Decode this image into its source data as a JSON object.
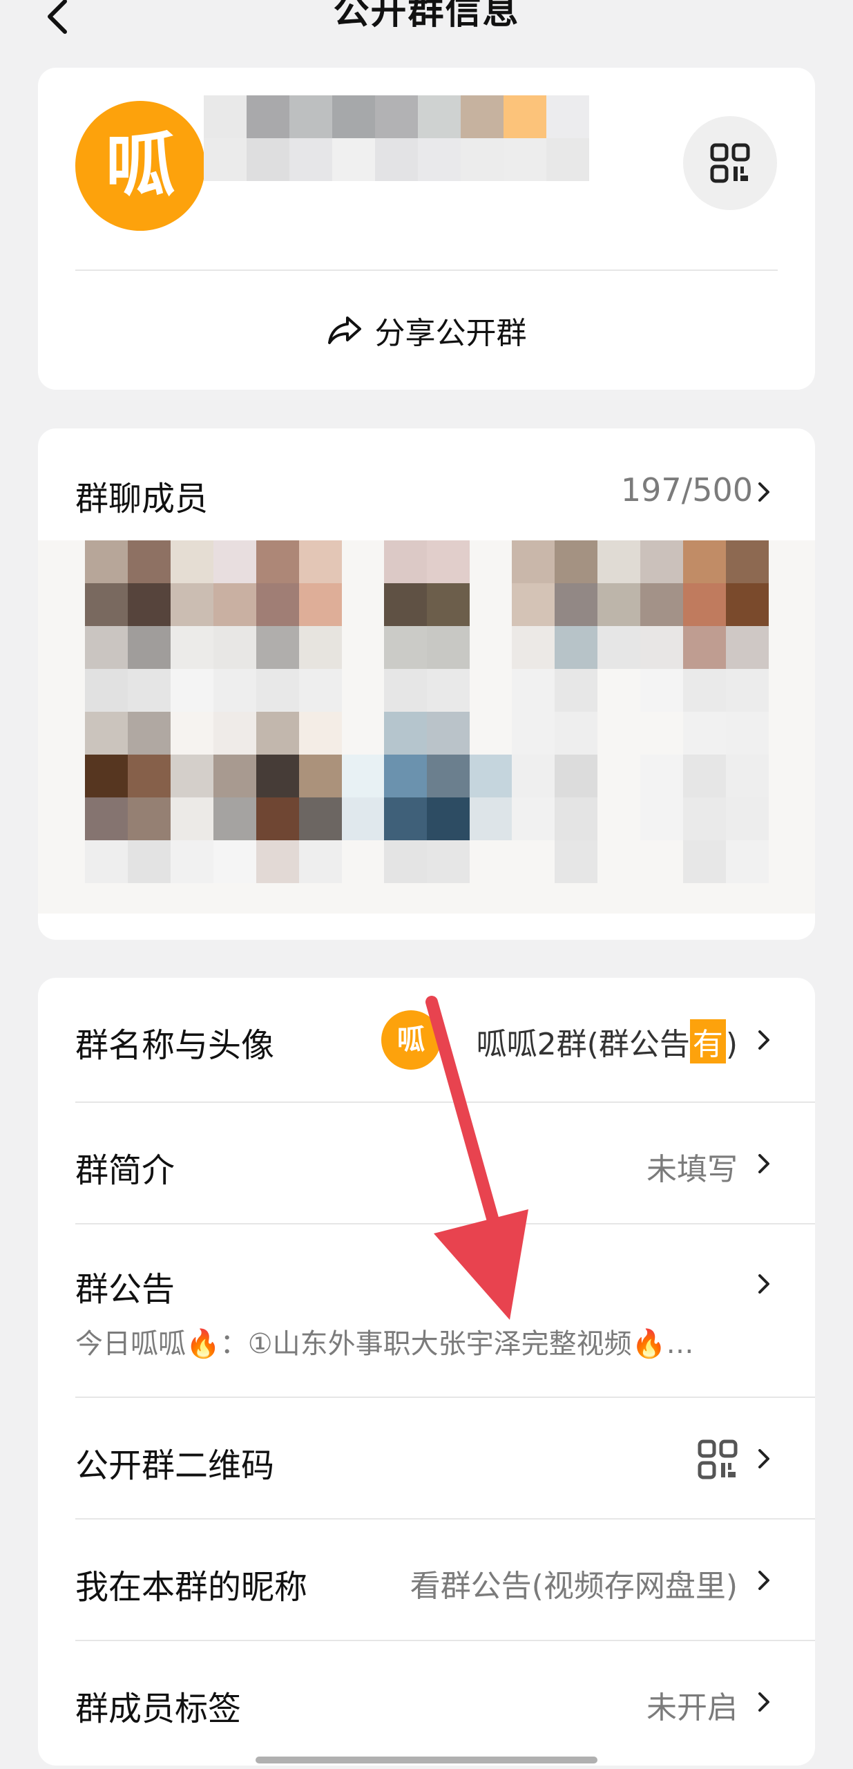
{
  "header": {
    "title": "公开群信息"
  },
  "group_card": {
    "avatar_text": "呱",
    "share_label": "分享公开群"
  },
  "members": {
    "title": "群聊成员",
    "count": "197/500"
  },
  "settings": {
    "name_avatar": {
      "label": "群名称与头像",
      "mini_avatar": "呱",
      "value_main": "呱呱2群(群公告",
      "value_tag": "有",
      "value_end": ")"
    },
    "intro": {
      "label": "群简介",
      "value": "未填写"
    },
    "notice": {
      "label": "群公告",
      "preview": "今日呱呱🔥：①山东外事职大张宇泽完整视频🔥…"
    },
    "qr": {
      "label": "公开群二维码"
    },
    "nickname": {
      "label": "我在本群的昵称",
      "value": "看群公告(视频存网盘里)"
    },
    "tags": {
      "label": "群成员标签",
      "value": "未开启"
    }
  },
  "colors": {
    "brand": "#fda20c",
    "arrow": "#e8434f"
  },
  "icons": [
    "back-icon",
    "qr-code-icon",
    "share-icon",
    "chevron-right-icon"
  ]
}
